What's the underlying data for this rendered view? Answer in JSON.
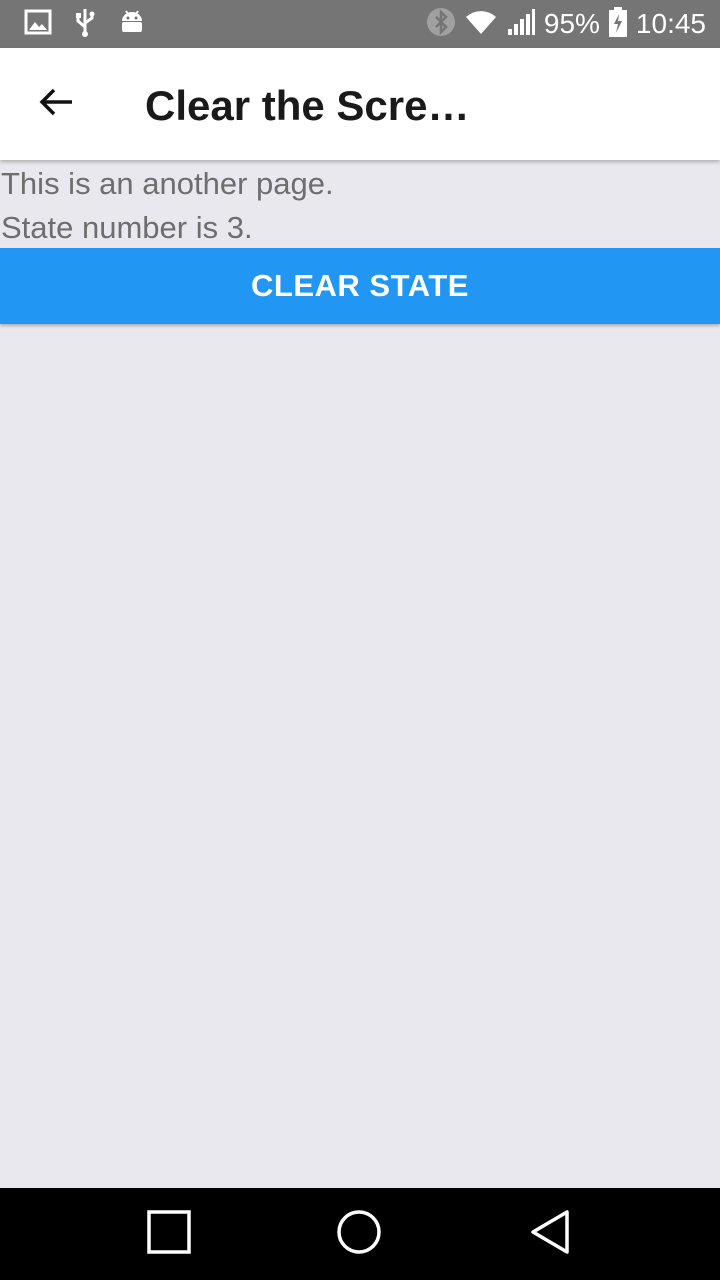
{
  "status_bar": {
    "battery": "95%",
    "time": "10:45",
    "icons": [
      "image-icon",
      "usb-icon",
      "android-icon",
      "bluetooth-icon",
      "wifi-icon",
      "signal-icon",
      "battery-charging-icon"
    ]
  },
  "app_bar": {
    "title": "Clear the Scree…",
    "back_icon": "arrow-back-icon"
  },
  "content": {
    "line1": "This is an another page.",
    "line2": "State number is 3.",
    "clear_button_label": "CLEAR STATE"
  },
  "nav_bar": {
    "icons": [
      "recent-apps-icon",
      "home-icon",
      "back-icon"
    ]
  },
  "colors": {
    "status_bar": "#757575",
    "app_bar": "#ffffff",
    "background": "#e9e8ee",
    "accent": "#2196f3",
    "nav_bar": "#000000"
  }
}
